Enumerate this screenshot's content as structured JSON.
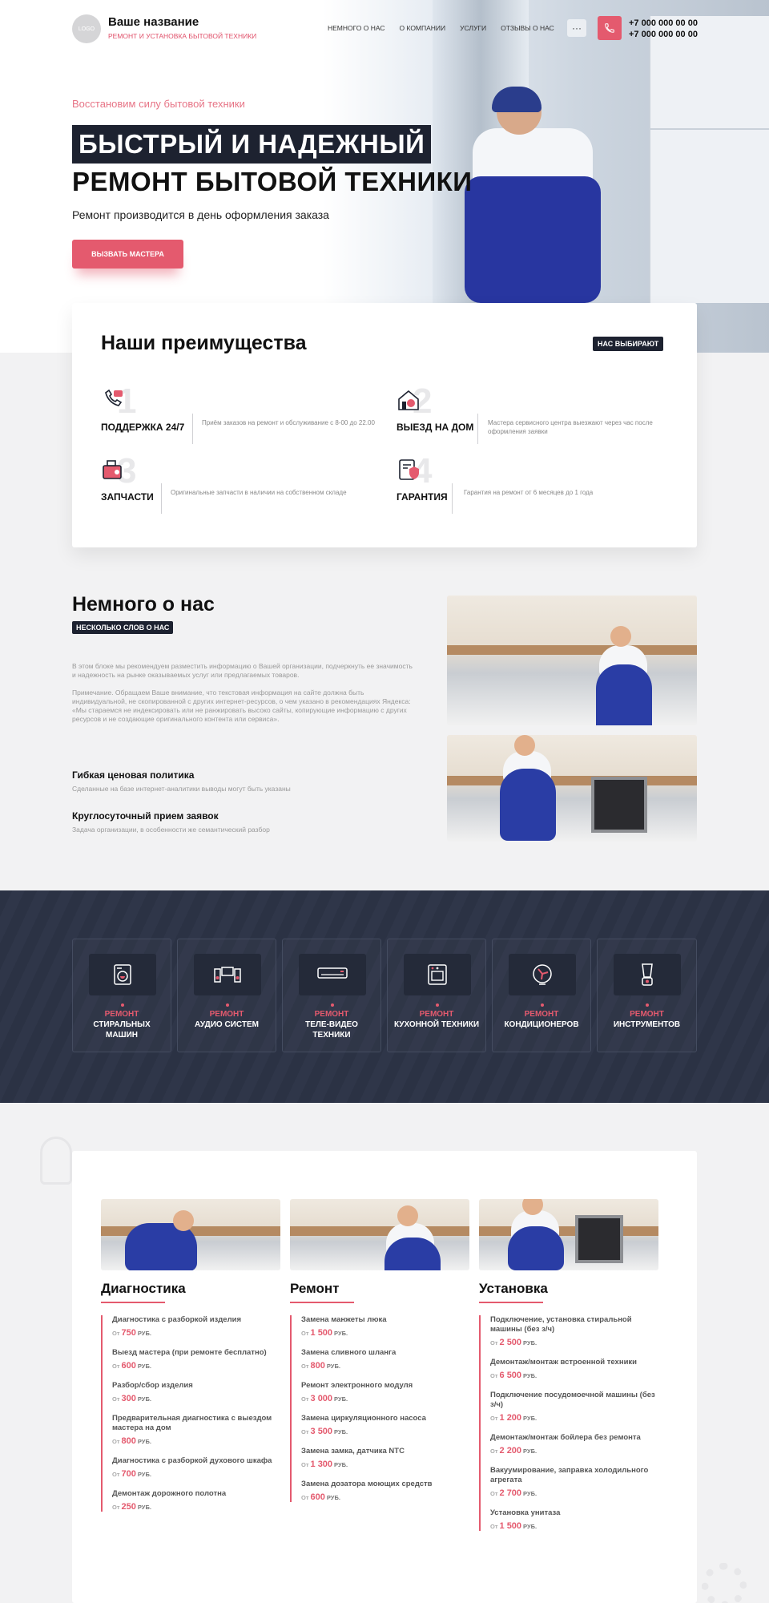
{
  "header": {
    "logo_text": "LOGO",
    "brand_name": "Ваше название",
    "brand_tagline": "РЕМОНТ И УСТАНОВКА БЫТОВОЙ ТЕХНИКИ",
    "nav": [
      "НЕМНОГО О НАС",
      "О КОМПАНИИ",
      "УСЛУГИ",
      "ОТЗЫВЫ О НАС"
    ],
    "more_label": "···",
    "phones": [
      "+7 000 000 00 00",
      "+7 000 000 00 00"
    ]
  },
  "hero": {
    "kicker": "Восстановим силу бытовой техники",
    "title_line1": "БЫСТРЫЙ И НАДЕЖНЫЙ",
    "title_line2": "РЕМОНТ БЫТОВОЙ ТЕХНИКИ",
    "lead": "Ремонт производится в день оформления заказа",
    "cta_label": "ВЫЗВАТЬ МАСТЕРА"
  },
  "advantages": {
    "title": "Наши преимущества",
    "badge": "НАС ВЫБИРАЮТ",
    "items": [
      {
        "num": "1",
        "name": "ПОДДЕРЖКА 24/7",
        "desc": "Приём заказов на ремонт и обслуживание с 8-00 до 22.00",
        "icon": "phone-support-icon"
      },
      {
        "num": "2",
        "name": "ВЫЕЗД НА ДОМ",
        "desc": "Мастера сервисного центра выезжают через час после оформления заявки",
        "icon": "house-icon"
      },
      {
        "num": "3",
        "name": "ЗАПЧАСТИ",
        "desc": "Оригинальные запчасти в наличии на собственном складе",
        "icon": "parts-icon"
      },
      {
        "num": "4",
        "name": "ГАРАНТИЯ",
        "desc": "Гарантия на ремонт от 6 месяцев до 1 года",
        "icon": "warranty-icon"
      }
    ]
  },
  "about": {
    "title": "Немного о нас",
    "tag": "НЕСКОЛЬКО СЛОВ О НАС",
    "p1": "В этом блоке мы рекомендуем разместить информацию о Вашей организации, подчеркнуть ее значимость и надежность на рынке оказываемых услуг или предлагаемых товаров.",
    "p2": "Примечание. Обращаем Ваше внимание, что текстовая информация на сайте должна быть индивидуальной, не скопированной с других интернет-ресурсов, о чем указано в рекомендациях Яндекса: «Мы стараемся не индексировать или не ранжировать высоко сайты, копирующие информацию с других ресурсов и не создающие оригинального контента или сервиса».",
    "features": [
      {
        "title": "Гибкая ценовая политика",
        "desc": "Сделанные на базе интернет-аналитики выводы могут быть указаны"
      },
      {
        "title": "Круглосуточный прием заявок",
        "desc": "Задача организации, в особенности же семантический разбор"
      }
    ]
  },
  "services": [
    {
      "red": "РЕМОНТ",
      "white": "СТИРАЛЬНЫХ МАШИН",
      "icon": "washing-machine-icon"
    },
    {
      "red": "РЕМОНТ",
      "white": "АУДИО СИСТЕМ",
      "icon": "audio-system-icon"
    },
    {
      "red": "РЕМОНТ",
      "white": "ТЕЛЕ-ВИДЕО ТЕХНИКИ",
      "icon": "air-conditioner-icon"
    },
    {
      "red": "РЕМОНТ",
      "white": "КУХОННОЙ ТЕХНИКИ",
      "icon": "oven-icon"
    },
    {
      "red": "РЕМОНТ",
      "white": "КОНДИЦИОНЕРОВ",
      "icon": "fan-icon"
    },
    {
      "red": "РЕМОНТ",
      "white": "ИНСТРУМЕНТОВ",
      "icon": "blender-icon"
    }
  ],
  "prices": {
    "from_label": "От",
    "currency": "РУБ.",
    "columns": [
      {
        "title": "Диагностика",
        "items": [
          {
            "name": "Диагностика с разборкой изделия",
            "price": "750"
          },
          {
            "name": "Выезд мастера (при ремонте бесплатно)",
            "price": "600"
          },
          {
            "name": "Разбор/сбор изделия",
            "price": "300"
          },
          {
            "name": "Предварительная диагностика с выездом мастера на дом",
            "price": "800"
          },
          {
            "name": "Диагностика с разборкой духового шкафа",
            "price": "700"
          },
          {
            "name": "Демонтаж дорожного полотна",
            "price": "250"
          }
        ]
      },
      {
        "title": "Ремонт",
        "items": [
          {
            "name": "Замена манжеты люка",
            "price": "1 500"
          },
          {
            "name": "Замена сливного шланга",
            "price": "800"
          },
          {
            "name": "Ремонт электронного модуля",
            "price": "3 000"
          },
          {
            "name": "Замена циркуляционного насоса",
            "price": "3 500"
          },
          {
            "name": "Замена замка, датчика NTC",
            "price": "1 300"
          },
          {
            "name": "Замена дозатора моющих средств",
            "price": "600"
          }
        ]
      },
      {
        "title": "Установка",
        "items": [
          {
            "name": "Подключение, установка стиральной машины (без з/ч)",
            "price": "2 500"
          },
          {
            "name": "Демонтаж/монтаж встроенной техники",
            "price": "6 500"
          },
          {
            "name": "Подключение посудомоечной машины (без з/ч)",
            "price": "1 200"
          },
          {
            "name": "Демонтаж/монтаж бойлера без ремонта",
            "price": "2 200"
          },
          {
            "name": "Вакуумирование, заправка холодильного агрегата",
            "price": "2 700"
          },
          {
            "name": "Установка унитаза",
            "price": "1 500"
          }
        ]
      }
    ]
  }
}
